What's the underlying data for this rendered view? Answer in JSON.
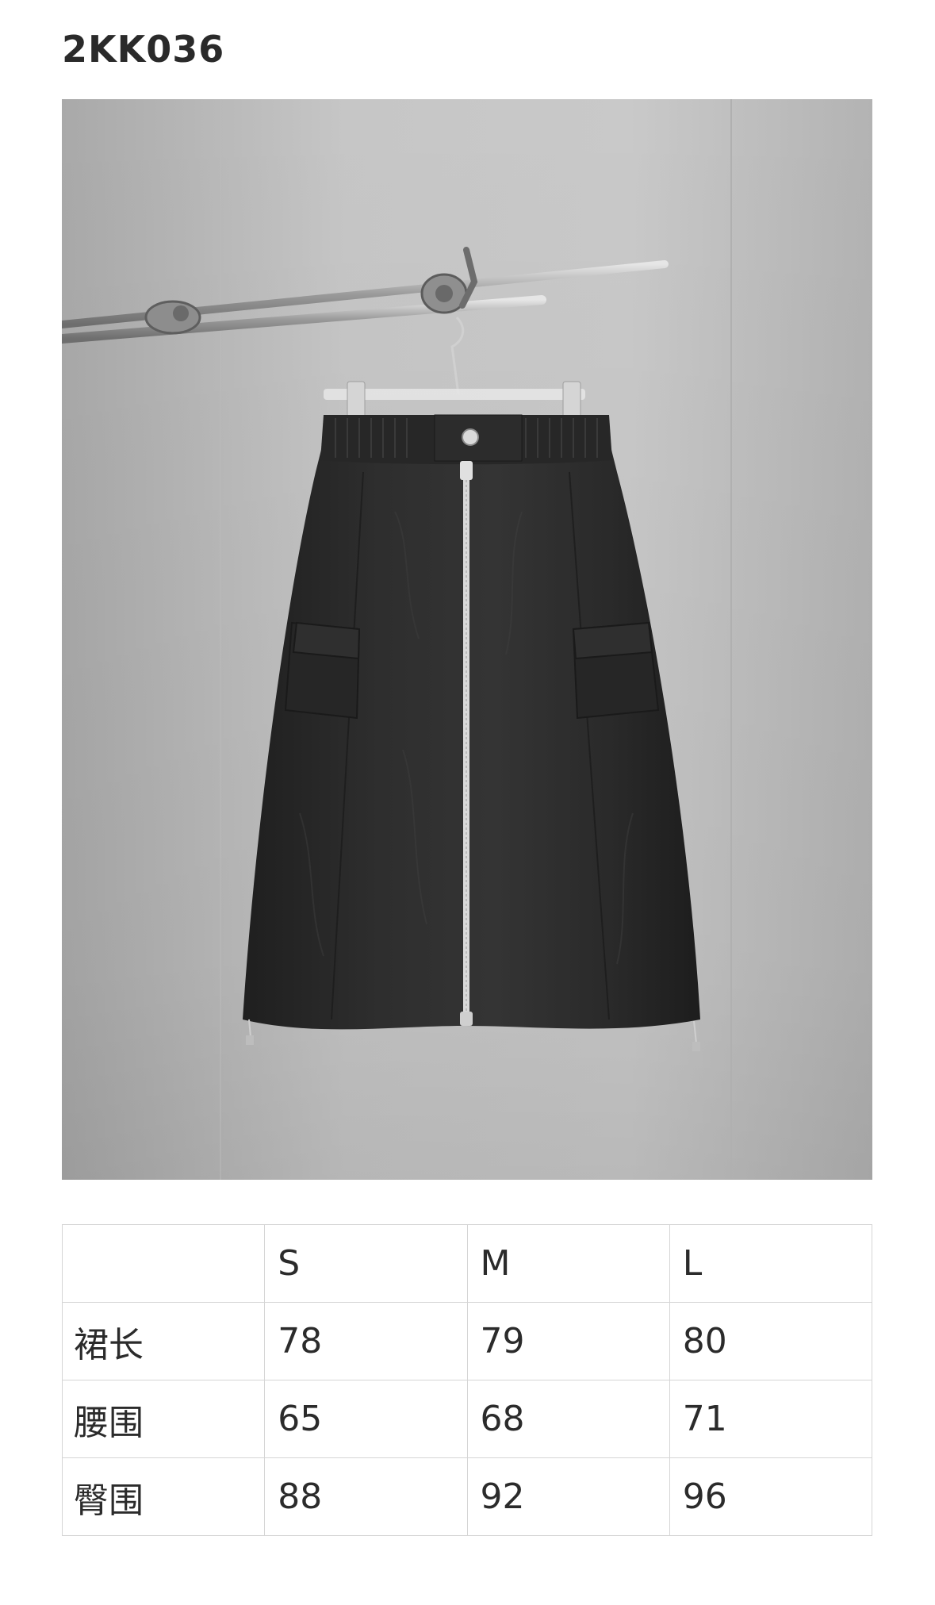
{
  "product": {
    "code": "2KK036"
  },
  "size_table": {
    "header": [
      "",
      "S",
      "M",
      "L"
    ],
    "rows": [
      {
        "label": "裙长",
        "values": [
          "78",
          "79",
          "80"
        ]
      },
      {
        "label": "腰围",
        "values": [
          "65",
          "68",
          "71"
        ]
      },
      {
        "label": "臀围",
        "values": [
          "88",
          "92",
          "96"
        ]
      }
    ]
  },
  "colors": {
    "background_wall": "#bdbdbd",
    "skirt": "#2b2b2b",
    "zipper": "#d9d9d9"
  }
}
